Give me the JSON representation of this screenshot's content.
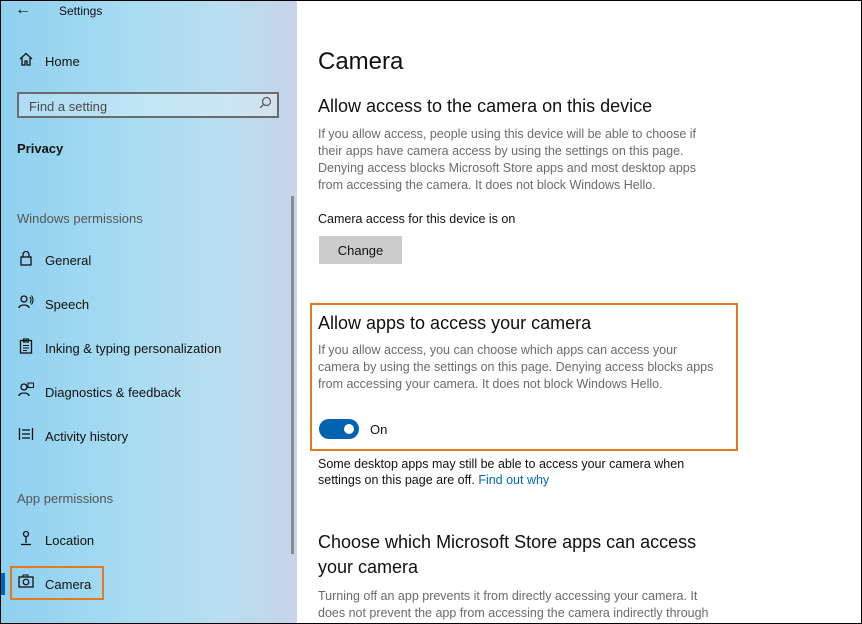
{
  "window": {
    "title": "Settings"
  },
  "sidebar": {
    "home_label": "Home",
    "search_placeholder": "Find a setting",
    "section_title": "Privacy",
    "windows_permissions_label": "Windows permissions",
    "windows_permissions": [
      {
        "label": "General",
        "icon": "lock-icon"
      },
      {
        "label": "Speech",
        "icon": "speech-icon"
      },
      {
        "label": "Inking & typing personalization",
        "icon": "clipboard-icon"
      },
      {
        "label": "Diagnostics & feedback",
        "icon": "feedback-icon"
      },
      {
        "label": "Activity history",
        "icon": "activity-history-icon"
      }
    ],
    "app_permissions_label": "App permissions",
    "app_permissions": [
      {
        "label": "Location",
        "icon": "location-icon"
      },
      {
        "label": "Camera",
        "icon": "camera-icon",
        "selected": true
      }
    ]
  },
  "main": {
    "page_title": "Camera",
    "device_access": {
      "heading": "Allow access to the camera on this device",
      "description": "If you allow access, people using this device will be able to choose if their apps have camera access by using the settings on this page. Denying access blocks Microsoft Store apps and most desktop apps from accessing the camera. It does not block Windows Hello.",
      "status": "Camera access for this device is on",
      "change_label": "Change"
    },
    "app_access": {
      "heading": "Allow apps to access your camera",
      "description": "If you allow access, you can choose which apps can access your camera by using the settings on this page. Denying access blocks apps from accessing your camera. It does not block Windows Hello.",
      "toggle_label": "On",
      "toggle_on": true,
      "note": "Some desktop apps may still be able to access your camera when settings on this page are off.",
      "note_link": "Find out why"
    },
    "store_apps": {
      "heading_line1": "Choose which Microsoft Store apps can access",
      "heading_line2": "your camera",
      "description": "Turning off an app prevents it from directly accessing your camera. It does not prevent the app from accessing the camera indirectly through"
    }
  },
  "colors": {
    "accent": "#0063b1",
    "highlight": "#e07b22",
    "link": "#0067b8"
  }
}
